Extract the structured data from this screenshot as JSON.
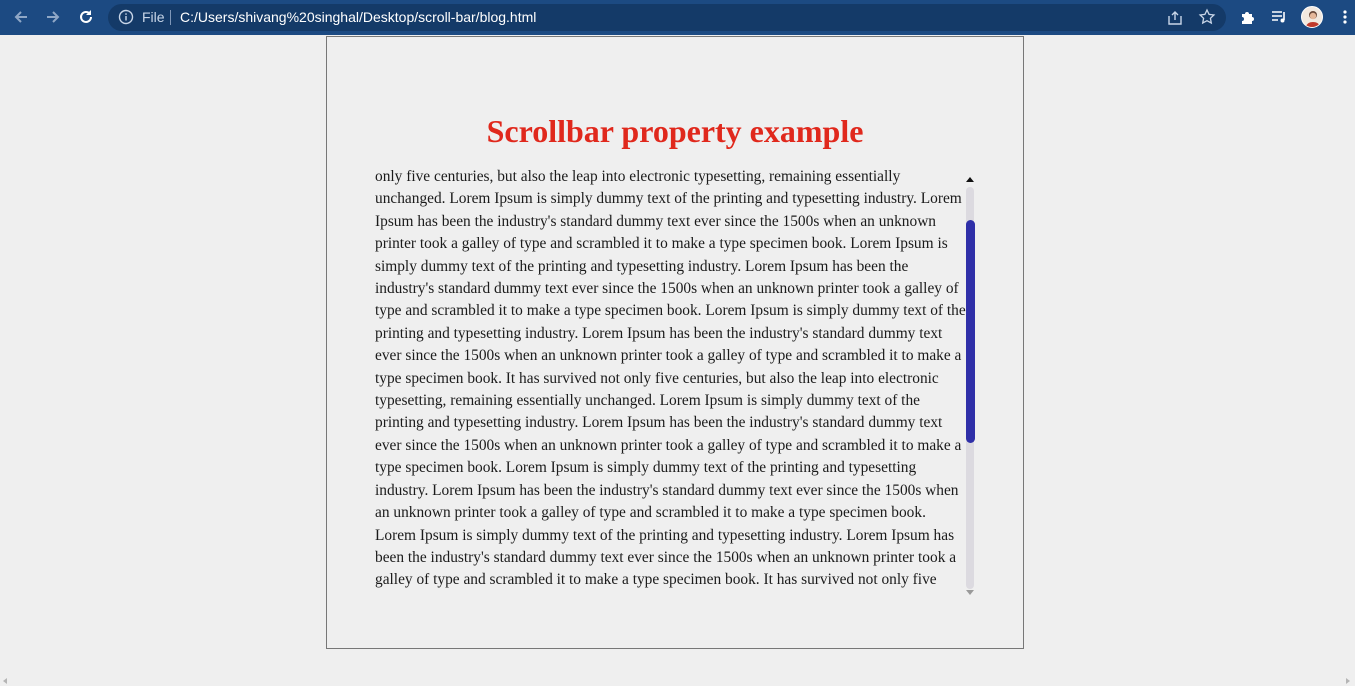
{
  "browser": {
    "url_scheme_label": "File",
    "url": "C:/Users/shivang%20singhal/Desktop/scroll-bar/blog.html",
    "icons": [
      "back-icon",
      "forward-icon",
      "reload-icon",
      "info-icon",
      "share-icon",
      "bookmark-star-icon",
      "extensions-icon",
      "reading-list-icon",
      "profile-avatar",
      "menu-icon"
    ],
    "accent_color": "#1c4a82"
  },
  "page": {
    "title": "Scrollbar property example",
    "title_color": "#e0281c",
    "scrollbar_thumb_color": "#2f2fa8",
    "scrollbar_track_color": "#dcdae0",
    "body_text": "only five centuries, but also the leap into electronic typesetting, remaining essentially unchanged. Lorem Ipsum is simply dummy text of the printing and typesetting industry. Lorem Ipsum has been the industry's standard dummy text ever since the 1500s when an unknown printer took a galley of type and scrambled it to make a type specimen book. Lorem Ipsum is simply dummy text of the printing and typesetting industry. Lorem Ipsum has been the industry's standard dummy text ever since the 1500s when an unknown printer took a galley of type and scrambled it to make a type specimen book. Lorem Ipsum is simply dummy text of the printing and typesetting industry. Lorem Ipsum has been the industry's standard dummy text ever since the 1500s when an unknown printer took a galley of type and scrambled it to make a type specimen book. It has survived not only five centuries, but also the leap into electronic typesetting, remaining essentially unchanged. Lorem Ipsum is simply dummy text of the printing and typesetting industry. Lorem Ipsum has been the industry's standard dummy text ever since the 1500s when an unknown printer took a galley of type and scrambled it to make a type specimen book. Lorem Ipsum is simply dummy text of the printing and typesetting industry. Lorem Ipsum has been the industry's standard dummy text ever since the 1500s when an unknown printer took a galley of type and scrambled it to make a type specimen book. Lorem Ipsum is simply dummy text of the printing and typesetting industry. Lorem Ipsum has been the industry's standard dummy text ever since the 1500s when an unknown printer took a galley of type and scrambled it to make a type specimen book. It has survived not only five centuries, but also the leap into electronic typesetting, remaining essentially unchanged."
  }
}
